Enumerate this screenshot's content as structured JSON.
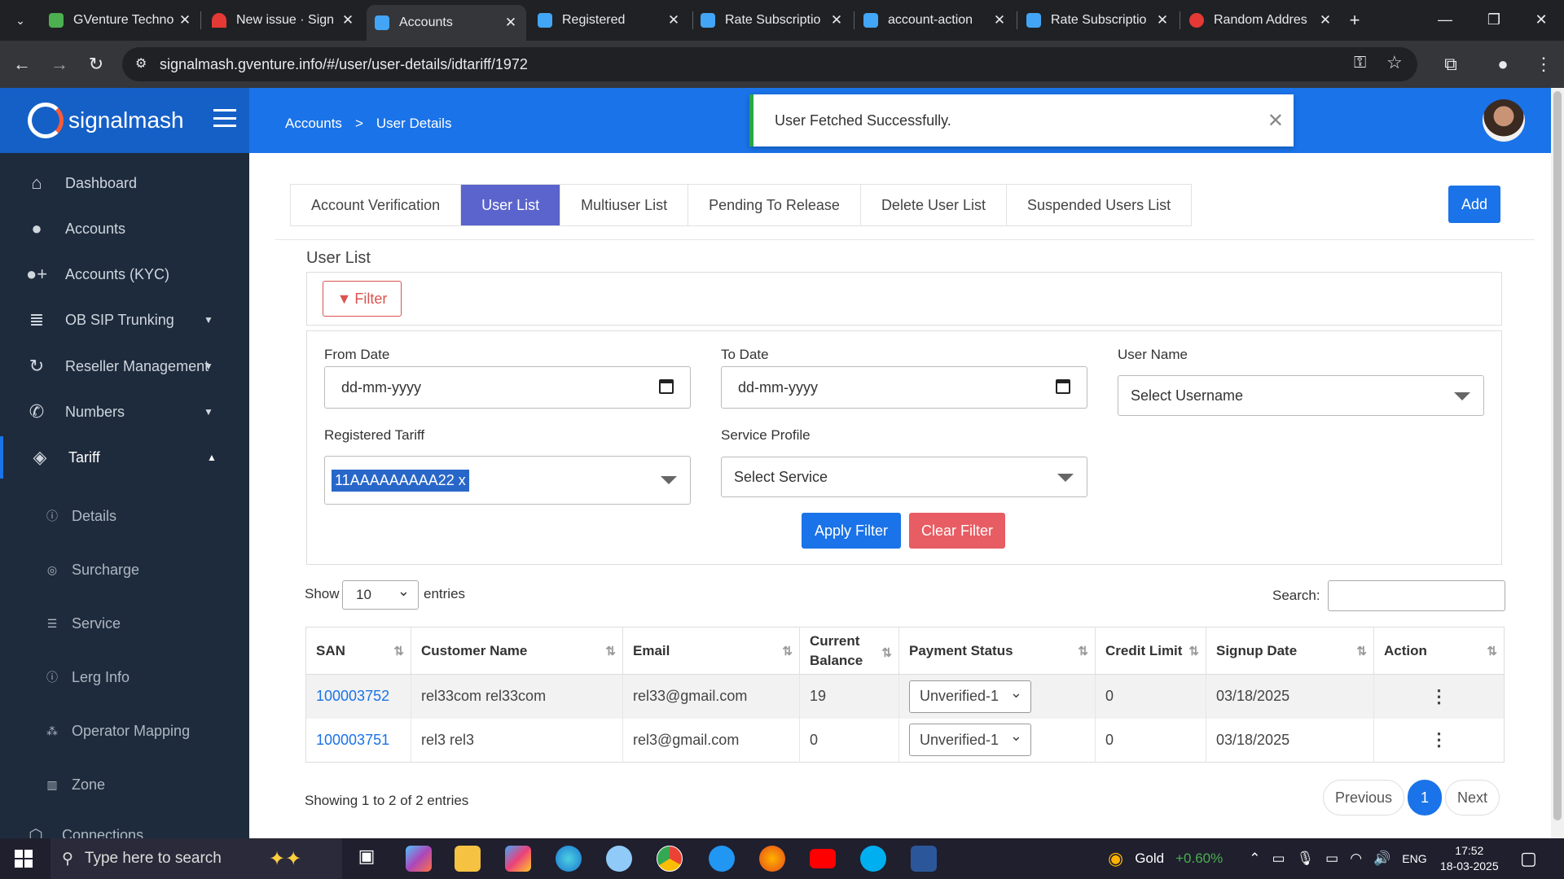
{
  "browser": {
    "tabs": [
      {
        "title": "GVenture Techno",
        "favicon_color": "#4caf50"
      },
      {
        "title": "New issue · Sign",
        "favicon_color": "#e53935"
      },
      {
        "title": "Accounts",
        "favicon_color": "#42a5f5"
      },
      {
        "title": "Registered",
        "favicon_color": "#42a5f5"
      },
      {
        "title": "Rate Subscriptio",
        "favicon_color": "#42a5f5"
      },
      {
        "title": "account-action",
        "favicon_color": "#42a5f5"
      },
      {
        "title": "Rate Subscriptio",
        "favicon_color": "#42a5f5"
      },
      {
        "title": "Random Addres",
        "favicon_color": "#e53935"
      }
    ],
    "url": "signalmash.gventure.info/#/user/user-details/idtariff/1972"
  },
  "header": {
    "brand": "signalmash",
    "breadcrumb_parent": "Accounts",
    "breadcrumb_current": "User Details"
  },
  "toast": {
    "message": "User Fetched Successfully."
  },
  "sidebar": {
    "items": [
      {
        "label": "Dashboard",
        "icon": "home-icon"
      },
      {
        "label": "Accounts",
        "icon": "user-icon"
      },
      {
        "label": "Accounts (KYC)",
        "icon": "user-plus-icon"
      },
      {
        "label": "OB SIP Trunking",
        "icon": "database-icon"
      },
      {
        "label": "Reseller Management",
        "icon": "refresh-icon"
      },
      {
        "label": "Numbers",
        "icon": "phone-icon"
      },
      {
        "label": "Tariff",
        "icon": "tag-icon"
      }
    ],
    "subitems": [
      {
        "label": "Details",
        "icon": "info-icon"
      },
      {
        "label": "Surcharge",
        "icon": "coins-icon"
      },
      {
        "label": "Service",
        "icon": "sliders-icon"
      },
      {
        "label": "Lerg Info",
        "icon": "info-icon"
      },
      {
        "label": "Operator Mapping",
        "icon": "sitemap-icon"
      },
      {
        "label": "Zone",
        "icon": "columns-icon"
      },
      {
        "label": "Connections",
        "icon": "network-icon"
      }
    ]
  },
  "page_tabs": [
    "Account Verification",
    "User List",
    "Multiuser List",
    "Pending To Release",
    "Delete User List",
    "Suspended Users List"
  ],
  "add_label": "Add",
  "section_title": "User List",
  "filter_label": "Filter",
  "form": {
    "from_date_label": "From Date",
    "from_date_placeholder": "dd-mm-yyyy",
    "to_date_label": "To Date",
    "to_date_placeholder": "dd-mm-yyyy",
    "username_label": "User Name",
    "username_placeholder": "Select Username",
    "tariff_label": "Registered Tariff",
    "tariff_selected": "11AAAAAAAAA22",
    "tariff_remove": "x",
    "service_label": "Service Profile",
    "service_placeholder": "Select Service",
    "apply_label": "Apply Filter",
    "clear_label": "Clear Filter"
  },
  "table_controls": {
    "show_label": "Show",
    "show_value": "10",
    "entries_label": "entries",
    "search_label": "Search:"
  },
  "table": {
    "columns": [
      "SAN",
      "Customer Name",
      "Email",
      "Current Balance",
      "Payment Status",
      "Credit Limit",
      "Signup Date",
      "Action"
    ],
    "rows": [
      {
        "san": "100003752",
        "name": "rel33com rel33com",
        "email": "rel33@gmail.com",
        "balance": "19",
        "status": "Unverified-1",
        "credit": "0",
        "signup": "03/18/2025"
      },
      {
        "san": "100003751",
        "name": "rel3 rel3",
        "email": "rel3@gmail.com",
        "balance": "0",
        "status": "Unverified-1",
        "credit": "0",
        "signup": "03/18/2025"
      }
    ]
  },
  "footer": {
    "showing": "Showing 1 to 2 of 2 entries",
    "prev": "Previous",
    "page": "1",
    "next": "Next"
  },
  "taskbar": {
    "search_placeholder": "Type here to search",
    "stock_name": "Gold",
    "stock_change": "+0.60%",
    "lang": "ENG",
    "time": "17:52",
    "date": "18-03-2025"
  }
}
